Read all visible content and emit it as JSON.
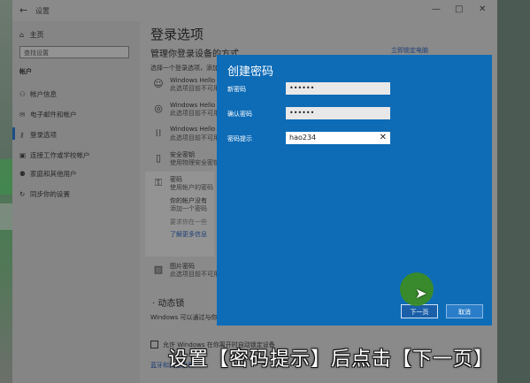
{
  "window": {
    "title": "设置",
    "controls": [
      "—",
      "□",
      "✕"
    ]
  },
  "sidebar": {
    "home": "主页",
    "search_placeholder": "查找设置",
    "section": "帐户",
    "items": [
      {
        "label": "帐户信息",
        "icon": "person-icon"
      },
      {
        "label": "电子邮件和帐户",
        "icon": "mail-icon"
      },
      {
        "label": "登录选项",
        "icon": "key-icon",
        "active": true
      },
      {
        "label": "连接工作或学校帐户",
        "icon": "briefcase-icon"
      },
      {
        "label": "家庭和其他用户",
        "icon": "people-icon"
      },
      {
        "label": "同步你的设置",
        "icon": "sync-icon"
      }
    ]
  },
  "main": {
    "title": "登录选项",
    "subtitle": "管理你登录设备的方式",
    "description": "选择一个登录选项，添加、",
    "right_link": "立即锁定电脑",
    "options": [
      {
        "title": "Windows Hello 人脸",
        "sub": "此选项目前不可用",
        "icon": "face-icon"
      },
      {
        "title": "Windows Hello 指纹",
        "sub": "此选项目前不可用",
        "icon": "fingerprint-icon"
      },
      {
        "title": "Windows Hello PIN",
        "sub": "此选项目前不可用",
        "icon": "pin-icon"
      },
      {
        "title": "安全密钥",
        "sub": "使用物理安全密钥",
        "icon": "usb-key-icon"
      }
    ],
    "password": {
      "title": "密码",
      "sub": "使用帐户的密码",
      "line1": "你的帐户没有",
      "line2": "添加一个密码",
      "add_button": "添加",
      "faded": "要求你在一些",
      "link": "了解更多信息"
    },
    "picture_password": {
      "title": "图片密码",
      "sub": "此选项目前不可用"
    },
    "dynamic_lock": {
      "title": "动态锁",
      "desc": "Windows 可以通过与你的电",
      "checkbox": "允许 Windows 在你离开时自动锁定设备",
      "link": "蓝牙和其他设备"
    }
  },
  "dialog": {
    "title": "创建密码",
    "new_password_label": "新密码",
    "new_password_value": "••••••",
    "confirm_label": "确认密码",
    "confirm_value": "••••••",
    "hint_label": "密码提示",
    "hint_value": "hao234",
    "next_button": "下一页",
    "cancel_button": "取消"
  },
  "caption": "设置【密码提示】后点击【下一页】",
  "colors": {
    "dialog_bg": "#0e6cb7",
    "cursor_highlight": "#3b8c24"
  }
}
